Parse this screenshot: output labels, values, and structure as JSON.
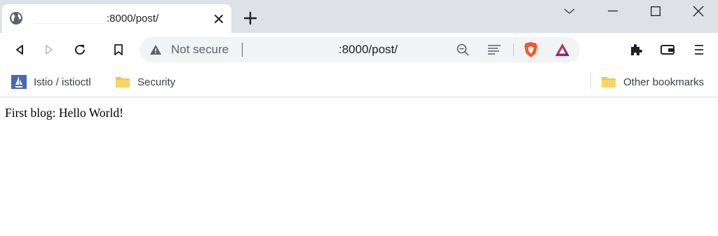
{
  "tab": {
    "title": ":8000/post/",
    "favicon": "globe-icon",
    "close_icon": "close-icon"
  },
  "window_controls": {
    "tab_search": "chevron-down-icon",
    "minimize": "minimize-icon",
    "maximize": "maximize-icon",
    "close": "close-icon"
  },
  "toolbar": {
    "back": "back-icon",
    "forward": "forward-icon",
    "reload": "reload-icon",
    "bookmark": "bookmark-icon"
  },
  "omnibox": {
    "security_label": "Not secure",
    "url": ":8000/post/",
    "icons": [
      "zoom-out-icon",
      "reader-mode-icon",
      "brave-shields-icon",
      "brave-rewards-icon"
    ]
  },
  "extensions": {
    "icons": [
      "extensions-icon",
      "wallet-icon",
      "menu-icon"
    ]
  },
  "bookmarks": {
    "items": [
      {
        "label": "Istio / istioctl",
        "icon": "istio-icon"
      },
      {
        "label": "Security",
        "icon": "folder-icon"
      }
    ],
    "other": {
      "label": "Other bookmarks",
      "icon": "folder-icon"
    }
  },
  "page": {
    "text": "First blog: Hello World!"
  },
  "colors": {
    "tabstrip": "#dee1e6",
    "omnibox": "#f1f3f4",
    "brave_orange": "#fb542b",
    "folder": "#f5c43d",
    "istio_blue": "#466bb0"
  }
}
